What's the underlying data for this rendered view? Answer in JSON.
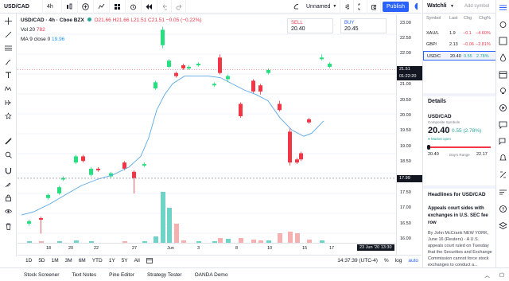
{
  "toolbar": {
    "symbol": "USD/CAD",
    "interval": "4h",
    "layout_name": "Unnamed",
    "publish_label": "Publish"
  },
  "legend": {
    "symbol_line": "USD/CAD · 4h · Cboe BZX",
    "ohlc": "O21.66 H21.66 L21.51 C21.51 −0.05 (−0.22%)",
    "vol_label": "Vol 20",
    "vol_value": "782",
    "ma_label": "MA 9 close 0",
    "ma_value": "19.96"
  },
  "order": {
    "sell_label": "SELL",
    "sell_price": "20.40",
    "buy_label": "BUY",
    "buy_price": "20.45"
  },
  "price_axis": {
    "labels": [
      "23.00",
      "22.50",
      "22.00",
      "21.00",
      "20.50",
      "20.00",
      "19.50",
      "19.00",
      "18.50",
      "18.00",
      "17.50",
      "17.00",
      "16.50",
      "16.00"
    ],
    "last_price": "21.51",
    "countdown": "01:22:20",
    "crosshair_price": "17.99"
  },
  "time_axis": {
    "labels": [
      "18",
      "20",
      "22",
      "27",
      "Jun",
      "3",
      "8",
      "10",
      "15",
      "17"
    ],
    "crosshair_time": "23 Jun '20  13:30"
  },
  "bottom": {
    "ranges": [
      "1D",
      "5D",
      "1M",
      "3M",
      "6M",
      "YTD",
      "1Y",
      "5Y",
      "All"
    ],
    "clock": "14:37:39 (UTC-4)",
    "pct": "%",
    "log": "log",
    "auto": "auto"
  },
  "footer": {
    "tabs": [
      "Stock Screener",
      "Text Notes",
      "Pine Editor",
      "Strategy Tester",
      "OANDA Demo"
    ]
  },
  "watchlist": {
    "title": "Watchli",
    "add_label": "Add symbol",
    "headers": [
      "Symbol",
      "Last",
      "Chg",
      "Chg%"
    ],
    "rows": [
      {
        "symbol": "XAU/L",
        "last": "1.9",
        "chg": "−0.1",
        "chgp": "−4.60%",
        "dir": "neg"
      },
      {
        "symbol": "GBP/",
        "last": "2.13",
        "chg": "−0.06",
        "chgp": "−2.81%",
        "dir": "neg"
      },
      {
        "symbol": "USD/C",
        "last": "20.40",
        "chg": "0.55",
        "chgp": "2.78%",
        "dir": "pos"
      }
    ]
  },
  "details": {
    "title": "Details",
    "symbol": "USD/CAD",
    "sub": "Composite Symbols",
    "price": "20.40",
    "change": "0.55 (2.78%)",
    "market": "Market open",
    "range_low": "20.40",
    "range_label": "Day's Range",
    "range_high": "22.17"
  },
  "headlines": {
    "title": "Headlines for USD/CAD",
    "headline": "Appeals court sides with exchanges in U.S. SEC fee row",
    "body": "By John McCrank NEW YORK, June 16 (Reuters) - A U.S. appeals court ruled on Tuesday that the Securities and Exchange Commission cannot force stock exchanges to conduct a..."
  },
  "colors": {
    "up": "#26e07f",
    "down": "#f23645",
    "ma": "#5aa9e6",
    "vol_up": "#6fd3c7",
    "vol_down": "#f7b0b0",
    "accent": "#2962ff"
  }
}
